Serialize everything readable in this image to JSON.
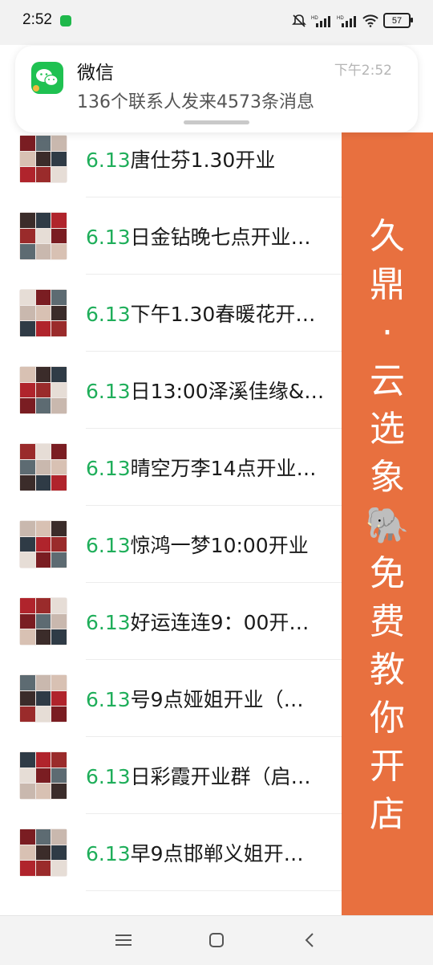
{
  "status_bar": {
    "time": "2:52",
    "battery": "57",
    "icons": [
      "wechat-notification-icon",
      "mute-bell-icon",
      "signal-hd-icon",
      "signal-hd-icon",
      "wifi-icon",
      "battery-icon"
    ]
  },
  "notification": {
    "app": "微信",
    "time": "下午2:52",
    "message": "136个联系人发来4573条消息"
  },
  "chats": [
    {
      "date": "6.13",
      "title": "唐仕芬1.30开业"
    },
    {
      "date": "6.13",
      "title": "日金钻晚七点开业…"
    },
    {
      "date": "6.13",
      "title": "下午1.30春暖花开…"
    },
    {
      "date": "6.13",
      "title": "日13:00泽溪佳缘&…"
    },
    {
      "date": "6.13",
      "title": "晴空万李14点开业…"
    },
    {
      "date": "6.13",
      "title": "惊鸿一梦10:00开业"
    },
    {
      "date": "6.13",
      "title": "好运连连9：00开…"
    },
    {
      "date": "6.13",
      "title": "号9点娅姐开业（…"
    },
    {
      "date": "6.13",
      "title": "日彩霞开业群（启…"
    },
    {
      "date": "6.13",
      "title": "早9点邯郸义姐开…"
    }
  ],
  "banner": {
    "chars": [
      "久",
      "鼎",
      "·",
      "云",
      "选",
      "象",
      "🐘",
      "免",
      "费",
      "教",
      "你",
      "开",
      "店"
    ],
    "color": "#e8703f"
  },
  "colors": {
    "date_accent": "#1fae5a",
    "wechat_green": "#1fc151"
  },
  "navbar": {
    "buttons": [
      "menu-icon",
      "home-square-icon",
      "back-chevron-icon"
    ]
  }
}
